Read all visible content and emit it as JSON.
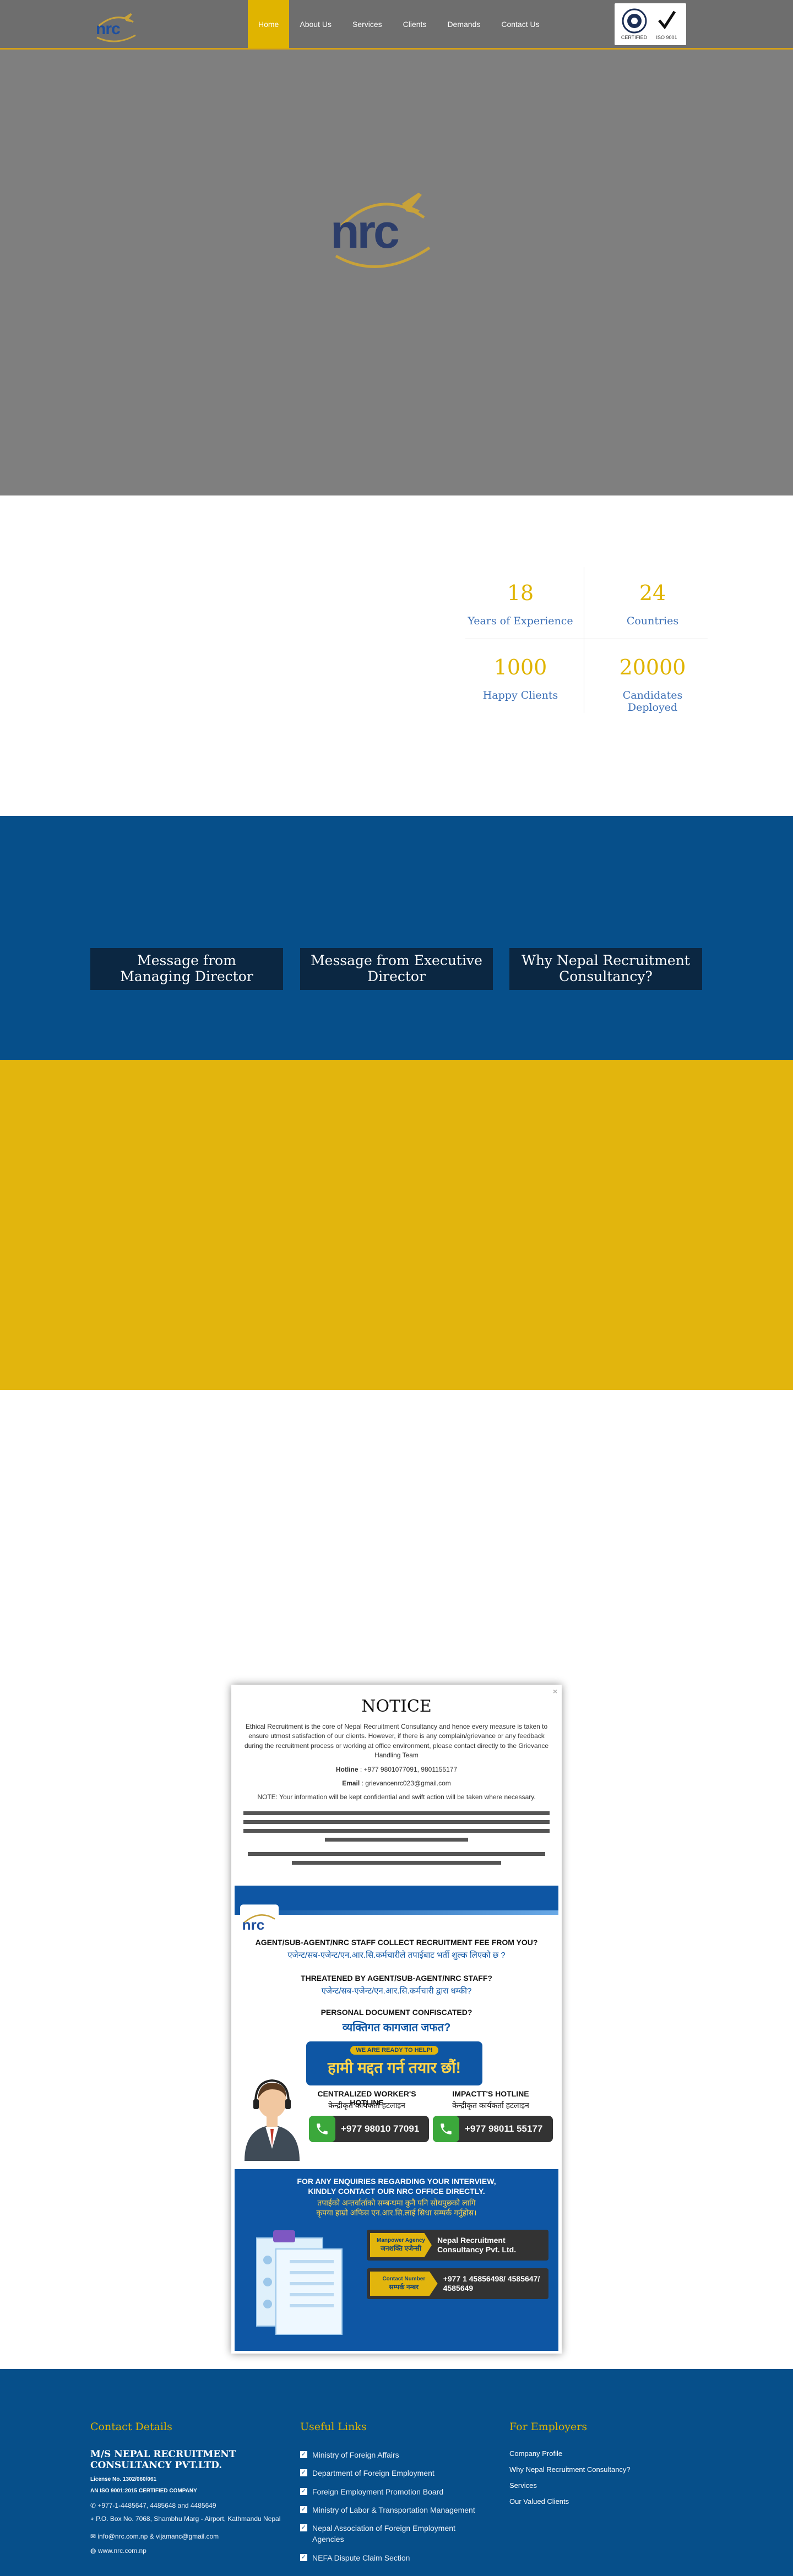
{
  "header": {
    "nav": [
      {
        "label": "Home",
        "active": true
      },
      {
        "label": "About Us",
        "active": false
      },
      {
        "label": "Services",
        "active": false
      },
      {
        "label": "Clients",
        "active": false
      },
      {
        "label": "Demands",
        "active": false
      },
      {
        "label": "Contact Us",
        "active": false
      }
    ],
    "cert_left": "CERTIFIED",
    "cert_right": "ISO 9001"
  },
  "brand": {
    "logo_text": "nrc",
    "accent": "#e0b400",
    "blue": "#064f8a",
    "yellow": "#e2b50d"
  },
  "stats": [
    {
      "value": "18",
      "label": "Years of Experience"
    },
    {
      "value": "24",
      "label": "Countries"
    },
    {
      "value": "1000",
      "label": "Happy Clients"
    },
    {
      "value": "20000",
      "label": "Candidates Deployed"
    }
  ],
  "messages": [
    "Message from Managing Director",
    "Message from Executive Director",
    "Why Nepal Recruitment Consultancy?"
  ],
  "notice": {
    "close": "×",
    "title": "NOTICE",
    "intro": "Ethical Recruitment is the core of Nepal Recruitment Consultancy and hence every measure is taken to ensure utmost satisfaction of our clients. However, if there is any complain/grievance or any feedback during the recruitment process or working at office environment, please contact directly to the Grievance Handling Team",
    "hotline_label": "Hotline",
    "hotline_value": ": +977 9801077091, 9801155177",
    "email_label": "Email",
    "email_value": ": grievancenrc023@gmail.com",
    "confidential": "NOTE: Your information will be kept confidential and swift action will be taken where necessary.",
    "poster": {
      "line1": "AGENT/SUB-AGENT/NRC STAFF COLLECT RECRUITMENT FEE FROM YOU?",
      "line1_np": "एजेन्ट/सब-एजेन्ट/एन.आर.सि.कर्मचारीले तपाईबाट भर्ती शुल्क लिएको छ ?",
      "line2": "THREATENED BY AGENT/SUB-AGENT/NRC STAFF?",
      "line2_np": "एजेन्ट/सब-एजेन्ट/एन.आर.सि.कर्मचारी द्वारा धम्की?",
      "line3": "PERSONAL DOCUMENT CONFISCATED?",
      "line3_np": "व्यक्तिगत कागजात जफत?",
      "ready": "WE ARE READY TO HELP!",
      "ready_np": "हामी मद्दत गर्न तयार छौं!",
      "hot1_title": "CENTRALIZED WORKER'S HOTLINE",
      "hot1_np": "केन्द्रीकृत कार्यकर्ता हटलाइन",
      "hot1_num": "+977 98010 77091",
      "hot2_title": "IMPACTT'S HOTLINE",
      "hot2_np": "केन्द्रीकृत कार्यकर्ता हटलाइन",
      "hot2_num": "+977 98011 55177",
      "enq1": "FOR ANY ENQUIRIES REGARDING YOUR INTERVIEW,",
      "enq2": "KINDLY CONTACT OUR NRC OFFICE DIRECTLY.",
      "enq_np1": "तपाईको अन्तर्वार्ताको सम्बन्धमा कुनै पनि सोधपुछको लागि",
      "enq_np2": "कृपया हाम्रो अफिस एन.आर.सि.लाई सिधा सम्पर्क गर्नुहोस।",
      "agency_label": "Manpower Agency",
      "agency_label_np": "जनशक्ति एजेन्सी",
      "agency_value": "Nepal Recruitment Consultancy Pvt. Ltd.",
      "contact_label": "Contact Number",
      "contact_label_np": "सम्पर्क नम्बर",
      "contact_value": "+977 1 45856498/ 4585647/ 4585649"
    }
  },
  "footer": {
    "contact_heading": "Contact Details",
    "company": "M/S NEPAL RECRUITMENT CONSULTANCY PVT.LTD.",
    "license": "License No. 1302/060/061",
    "iso": "AN ISO 9001:2015 CERTIFIED COMPANY",
    "phone": "+977-1-4485647, 4485648 and 4485649",
    "address": "P.O. Box No. 7068, Shambhu Marg - Airport, Kathmandu Nepal",
    "email": "info@nrc.com.np & vijamanc@gmail.com",
    "web": "www.nrc.com.np",
    "useful_heading": "Useful Links",
    "useful": [
      "Ministry of Foreign Affairs",
      "Department of Foreign Employment",
      "Foreign Employment Promotion Board",
      "Ministry of Labor & Transportation Management",
      "Nepal Association of Foreign Employment Agencies",
      "NEFA Dispute Claim Section"
    ],
    "employers_heading": "For Employers",
    "employers": [
      "Company Profile",
      "Why Nepal Recruitment Consultancy?",
      "Services",
      "Our Valued Clients"
    ]
  }
}
